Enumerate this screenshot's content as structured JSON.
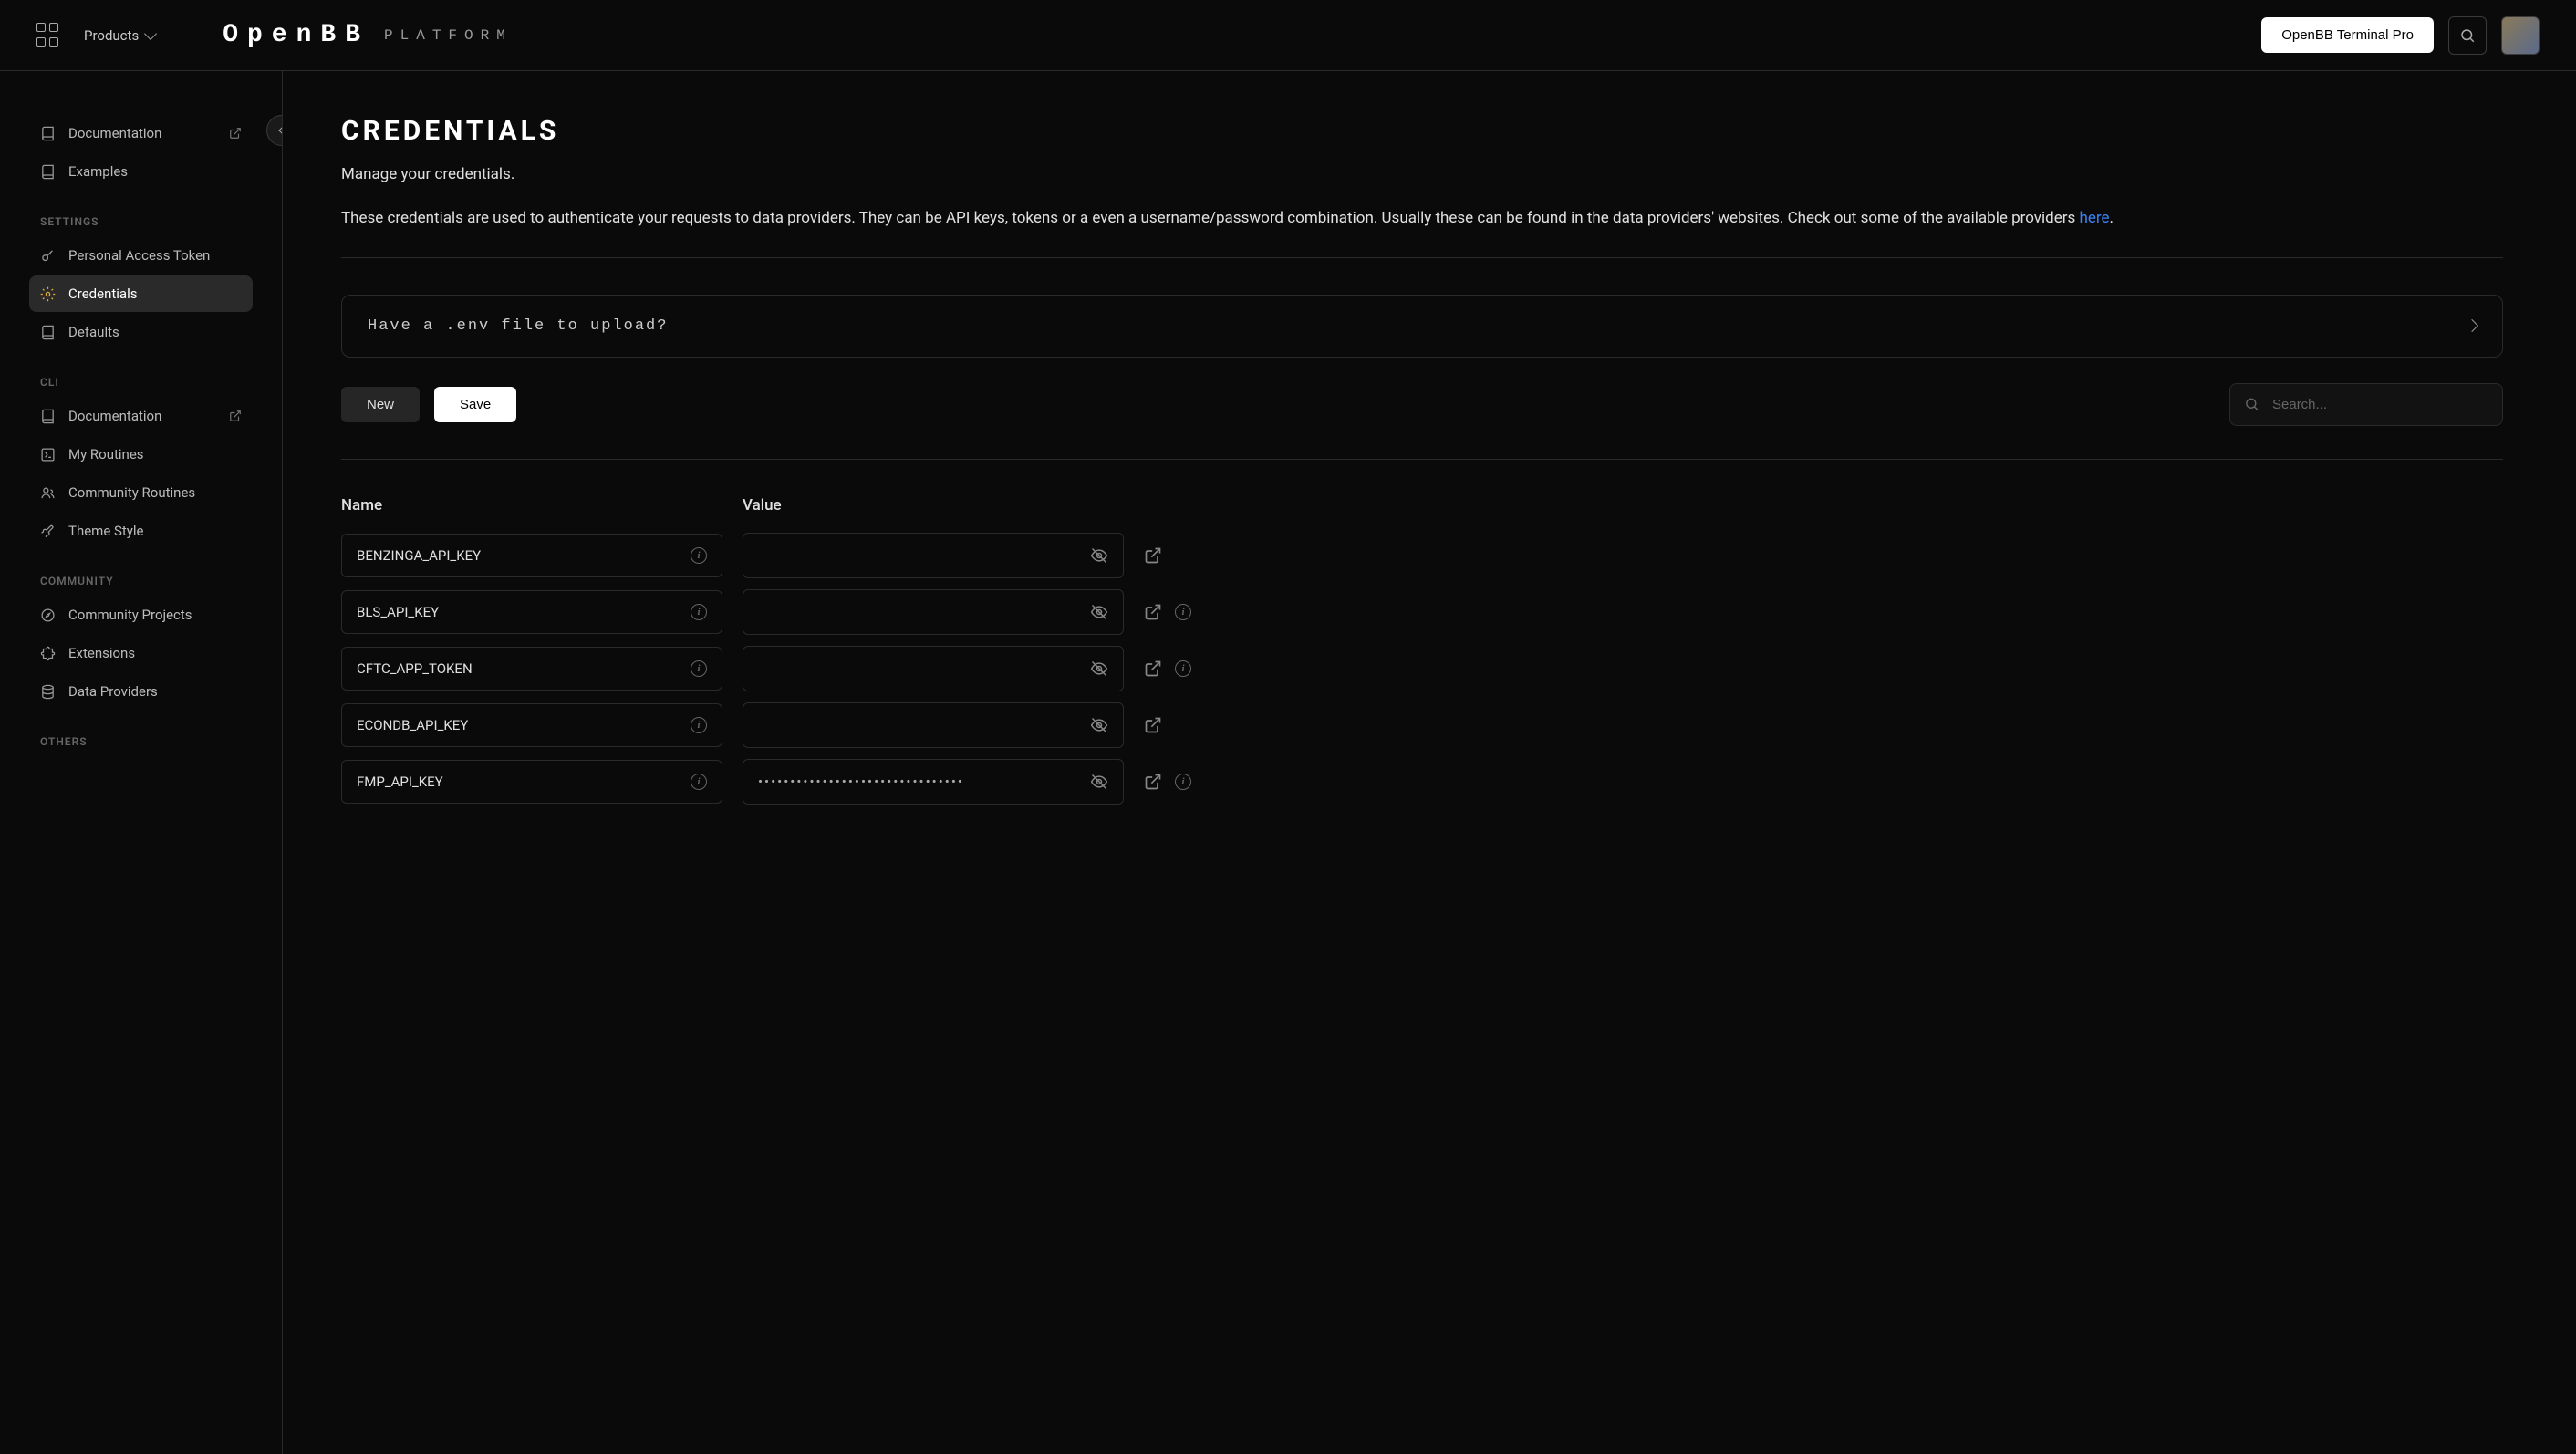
{
  "header": {
    "products_label": "Products",
    "logo_text": "OpenBB",
    "logo_secondary": "PLATFORM",
    "pro_button": "OpenBB Terminal Pro"
  },
  "sidebar": {
    "top_items": [
      {
        "label": "Documentation",
        "icon": "book",
        "external": true
      },
      {
        "label": "Examples",
        "icon": "book",
        "external": false
      }
    ],
    "sections": [
      {
        "heading": "SETTINGS",
        "items": [
          {
            "label": "Personal Access Token",
            "icon": "key",
            "external": false,
            "active": false
          },
          {
            "label": "Credentials",
            "icon": "gear",
            "external": false,
            "active": true
          },
          {
            "label": "Defaults",
            "icon": "book",
            "external": false,
            "active": false
          }
        ]
      },
      {
        "heading": "CLI",
        "items": [
          {
            "label": "Documentation",
            "icon": "book",
            "external": true,
            "active": false
          },
          {
            "label": "My Routines",
            "icon": "script",
            "external": false,
            "active": false
          },
          {
            "label": "Community Routines",
            "icon": "users",
            "external": false,
            "active": false
          },
          {
            "label": "Theme Style",
            "icon": "brush",
            "external": false,
            "active": false
          }
        ]
      },
      {
        "heading": "COMMUNITY",
        "items": [
          {
            "label": "Community Projects",
            "icon": "compass",
            "external": false,
            "active": false
          },
          {
            "label": "Extensions",
            "icon": "puzzle",
            "external": false,
            "active": false
          },
          {
            "label": "Data Providers",
            "icon": "database",
            "external": false,
            "active": false
          }
        ]
      },
      {
        "heading": "OTHERS",
        "items": []
      }
    ]
  },
  "page": {
    "title": "CREDENTIALS",
    "subtitle": "Manage your credentials.",
    "description_1": "These credentials are used to authenticate your requests to data providers. They can be API keys, tokens or a even a username/password combination. Usually these can be found in the data providers' websites. Check out some of the available providers ",
    "description_link": "here",
    "description_2": ".",
    "upload_prompt": "Have a .env file to upload?",
    "new_button": "New",
    "save_button": "Save",
    "search_placeholder": "Search...",
    "col_name": "Name",
    "col_value": "Value"
  },
  "credentials": [
    {
      "name": "BENZINGA_API_KEY",
      "value": "",
      "has_extra_info": false
    },
    {
      "name": "BLS_API_KEY",
      "value": "",
      "has_extra_info": true
    },
    {
      "name": "CFTC_APP_TOKEN",
      "value": "",
      "has_extra_info": true
    },
    {
      "name": "ECONDB_API_KEY",
      "value": "",
      "has_extra_info": false
    },
    {
      "name": "FMP_API_KEY",
      "value": "••••••••••••••••••••••••••••••••",
      "has_extra_info": true
    }
  ]
}
